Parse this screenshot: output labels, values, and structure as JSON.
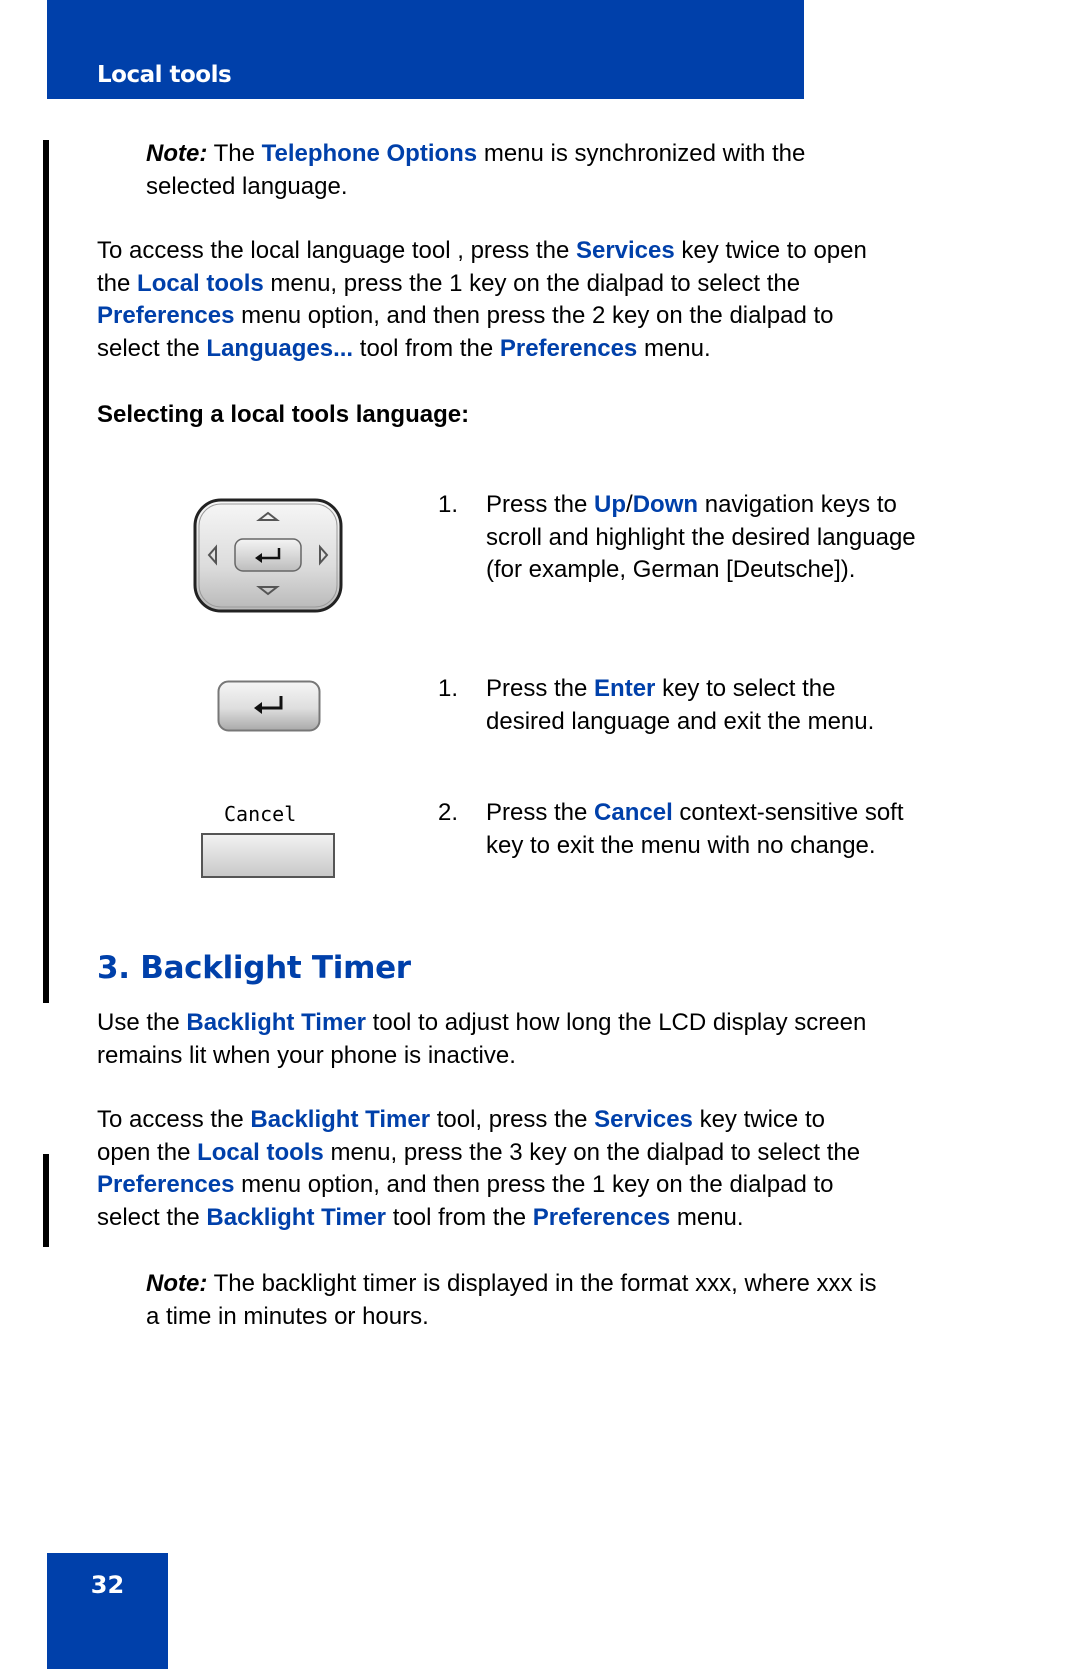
{
  "header": {
    "section_title": "Local tools"
  },
  "note_1": {
    "label": "Note:",
    "segments": [
      {
        "t": " The ",
        "hl": false
      },
      {
        "t": "Telephone Options",
        "hl": true
      },
      {
        "t": " menu is synchronized with the",
        "hl": false
      }
    ],
    "line2": "selected language."
  },
  "para_access_language": {
    "lines": [
      [
        {
          "t": "To access the local language tool , press the ",
          "hl": false
        },
        {
          "t": "Services",
          "hl": true
        },
        {
          "t": " key twice to open",
          "hl": false
        }
      ],
      [
        {
          "t": "the ",
          "hl": false
        },
        {
          "t": "Local tools",
          "hl": true
        },
        {
          "t": " menu, press the 1 key on the dialpad to select the",
          "hl": false
        }
      ],
      [
        {
          "t": "Preferences",
          "hl": true
        },
        {
          "t": " menu option, and then press the 2 key on the dialpad to",
          "hl": false
        }
      ],
      [
        {
          "t": "select the ",
          "hl": false
        },
        {
          "t": "Languages...",
          "hl": true
        },
        {
          "t": " tool from the ",
          "hl": false
        },
        {
          "t": "Preferences",
          "hl": true
        },
        {
          "t": " menu.",
          "hl": false
        }
      ]
    ]
  },
  "subheading": "Selecting a local tools language:",
  "steps": [
    {
      "number": "1.",
      "icon": "navigation-cluster-icon",
      "lines": [
        [
          {
            "t": "Press the ",
            "hl": false
          },
          {
            "t": "Up",
            "hl": true
          },
          {
            "t": "/",
            "hl": false
          },
          {
            "t": "Down",
            "hl": true
          },
          {
            "t": " navigation keys to",
            "hl": false
          }
        ],
        [
          {
            "t": "scroll and highlight the desired language",
            "hl": false
          }
        ],
        [
          {
            "t": "(for example, German [Deutsche]).",
            "hl": false
          }
        ]
      ]
    },
    {
      "number": "1.",
      "icon": "enter-key-icon",
      "lines": [
        [
          {
            "t": "Press the ",
            "hl": false
          },
          {
            "t": "Enter",
            "hl": true
          },
          {
            "t": " key to select the",
            "hl": false
          }
        ],
        [
          {
            "t": "desired language and exit the menu.",
            "hl": false
          }
        ]
      ]
    },
    {
      "number": "2.",
      "icon": "cancel-soft-key-icon",
      "softkey_label": "Cancel",
      "lines": [
        [
          {
            "t": "Press the ",
            "hl": false
          },
          {
            "t": "Cancel",
            "hl": true
          },
          {
            "t": " context-sensitive soft",
            "hl": false
          }
        ],
        [
          {
            "t": "key to exit the menu with no change.",
            "hl": false
          }
        ]
      ]
    }
  ],
  "section_heading": "3. Backlight Timer",
  "para_backlight_intro": {
    "lines": [
      [
        {
          "t": "Use the ",
          "hl": false
        },
        {
          "t": "Backlight Timer",
          "hl": true
        },
        {
          "t": " tool to adjust how long the LCD display screen",
          "hl": false
        }
      ],
      [
        {
          "t": "remains lit when your phone is inactive.",
          "hl": false
        }
      ]
    ]
  },
  "para_backlight_access": {
    "lines": [
      [
        {
          "t": "To access the ",
          "hl": false
        },
        {
          "t": "Backlight Timer",
          "hl": true
        },
        {
          "t": " tool, press the ",
          "hl": false
        },
        {
          "t": "Services",
          "hl": true
        },
        {
          "t": " key twice to",
          "hl": false
        }
      ],
      [
        {
          "t": "open the ",
          "hl": false
        },
        {
          "t": "Local tools",
          "hl": true
        },
        {
          "t": " menu, press the 3 key on the dialpad to select the",
          "hl": false
        }
      ],
      [
        {
          "t": "Preferences",
          "hl": true
        },
        {
          "t": " menu option, and then press the 1 key on the dialpad to",
          "hl": false
        }
      ],
      [
        {
          "t": "select the ",
          "hl": false
        },
        {
          "t": "Backlight Timer",
          "hl": true
        },
        {
          "t": " tool from the ",
          "hl": false
        },
        {
          "t": "Preferences",
          "hl": true
        },
        {
          "t": " menu.",
          "hl": false
        }
      ]
    ]
  },
  "note_2": {
    "label": "Note:",
    "line1": " The backlight timer is displayed in the format xxx, where xxx is",
    "line2": "a time in minutes or hours."
  },
  "footer": {
    "page_number": "32"
  },
  "colors": {
    "brand_blue": "#0040AA",
    "text": "#000000",
    "change_bar": "#000000"
  }
}
